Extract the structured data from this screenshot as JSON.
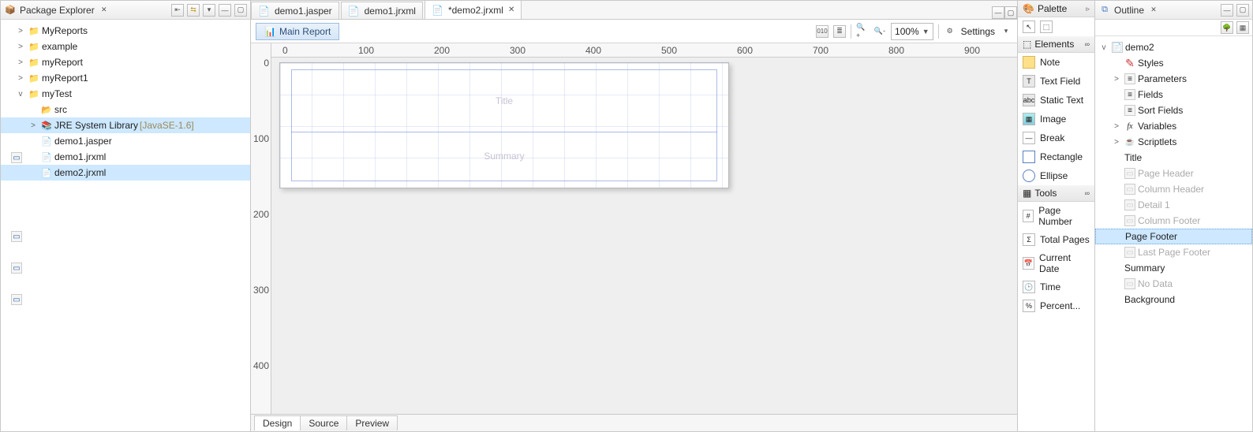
{
  "explorer": {
    "title": "Package Explorer",
    "items": [
      {
        "tw": ">",
        "icon": "📁",
        "label": "MyReports"
      },
      {
        "tw": ">",
        "icon": "📁",
        "label": "example"
      },
      {
        "tw": ">",
        "icon": "📁",
        "label": "myReport"
      },
      {
        "tw": ">",
        "icon": "📁",
        "label": "myReport1"
      },
      {
        "tw": "v",
        "icon": "📁",
        "label": "myTest"
      },
      {
        "tw": "",
        "icon": "📂",
        "label": "src",
        "indent": "indent2"
      },
      {
        "tw": ">",
        "icon": "📚",
        "label": "JRE System Library",
        "anno": "[JavaSE-1.6]",
        "indent": "indent2",
        "sel": true
      },
      {
        "tw": "",
        "icon": "📄",
        "label": "demo1.jasper",
        "indent": "indent2"
      },
      {
        "tw": "",
        "icon": "📄",
        "label": "demo1.jrxml",
        "indent": "indent2"
      },
      {
        "tw": "",
        "icon": "📄",
        "label": "demo2.jrxml",
        "indent": "indent2",
        "sel": true
      }
    ]
  },
  "editor": {
    "tabs": [
      {
        "label": "demo1.jasper"
      },
      {
        "label": "demo1.jrxml"
      },
      {
        "label": "*demo2.jrxml",
        "active": true
      }
    ],
    "mainReport": "Main Report",
    "zoom": "100%",
    "settings": "Settings",
    "hruler": [
      "0",
      "100",
      "200",
      "300",
      "400",
      "500",
      "600",
      "700",
      "800",
      "900"
    ],
    "vruler": [
      "0",
      "100",
      "200",
      "300",
      "400"
    ],
    "bands": {
      "title": "Title",
      "summary": "Summary"
    },
    "bottomTabs": [
      "Design",
      "Source",
      "Preview"
    ]
  },
  "palette": {
    "title": "Palette",
    "elementsHeader": "Elements",
    "items": [
      "Note",
      "Text Field",
      "Static Text",
      "Image",
      "Break",
      "Rectangle",
      "Ellipse"
    ],
    "toolsHeader": "Tools",
    "tools": [
      "Page Number",
      "Total Pages",
      "Current Date",
      "Time",
      "Percent..."
    ]
  },
  "outline": {
    "title": "Outline",
    "root": "demo2",
    "nodes": [
      {
        "tw": "v",
        "lvl": 1,
        "icon": "📄",
        "label": "demo2"
      },
      {
        "tw": "",
        "lvl": 2,
        "icon": "✎",
        "iconcls": "red",
        "label": "Styles"
      },
      {
        "tw": ">",
        "lvl": 2,
        "icon": "≡",
        "label": "Parameters"
      },
      {
        "tw": "",
        "lvl": 2,
        "icon": "≡",
        "label": "Fields"
      },
      {
        "tw": "",
        "lvl": 2,
        "icon": "≡",
        "label": "Sort Fields"
      },
      {
        "tw": ">",
        "lvl": 2,
        "icon": "fx",
        "iconcls": "fx",
        "label": "Variables"
      },
      {
        "tw": ">",
        "lvl": 2,
        "icon": "☕",
        "iconcls": "cup",
        "label": "Scriptlets"
      },
      {
        "tw": "",
        "lvl": 2,
        "icon": "▭",
        "iconcls": "band",
        "label": "Title"
      },
      {
        "tw": "",
        "lvl": 2,
        "icon": "▭",
        "iconcls": "banddis",
        "label": "Page Header",
        "dis": true
      },
      {
        "tw": "",
        "lvl": 2,
        "icon": "▭",
        "iconcls": "banddis",
        "label": "Column Header",
        "dis": true
      },
      {
        "tw": "",
        "lvl": 2,
        "icon": "▭",
        "iconcls": "banddis",
        "label": "Detail 1",
        "dis": true
      },
      {
        "tw": "",
        "lvl": 2,
        "icon": "▭",
        "iconcls": "banddis",
        "label": "Column Footer",
        "dis": true
      },
      {
        "tw": "",
        "lvl": 2,
        "icon": "▭",
        "iconcls": "band",
        "label": "Page Footer",
        "sel": true
      },
      {
        "tw": "",
        "lvl": 2,
        "icon": "▭",
        "iconcls": "banddis",
        "label": "Last Page Footer",
        "dis": true
      },
      {
        "tw": "",
        "lvl": 2,
        "icon": "▭",
        "iconcls": "band",
        "label": "Summary"
      },
      {
        "tw": "",
        "lvl": 2,
        "icon": "▭",
        "iconcls": "banddis",
        "label": "No Data",
        "dis": true
      },
      {
        "tw": "",
        "lvl": 2,
        "icon": "▭",
        "iconcls": "band",
        "label": "Background"
      }
    ]
  }
}
